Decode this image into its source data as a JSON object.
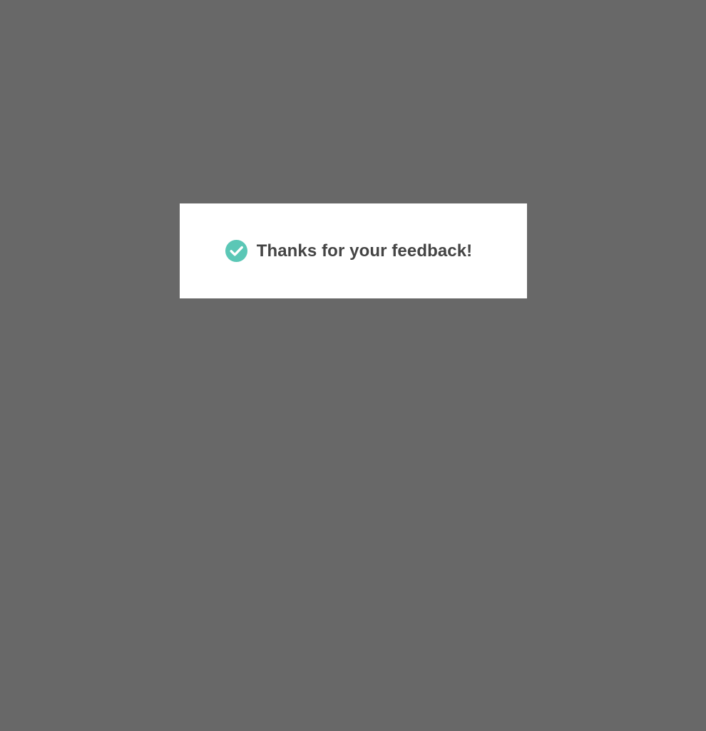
{
  "dialog": {
    "message": "Thanks for your feedback!",
    "icon": "check-circle-icon"
  },
  "colors": {
    "overlay": "#686868",
    "dialog_background": "#ffffff",
    "icon": "#5bc7b6",
    "text": "#444444"
  }
}
